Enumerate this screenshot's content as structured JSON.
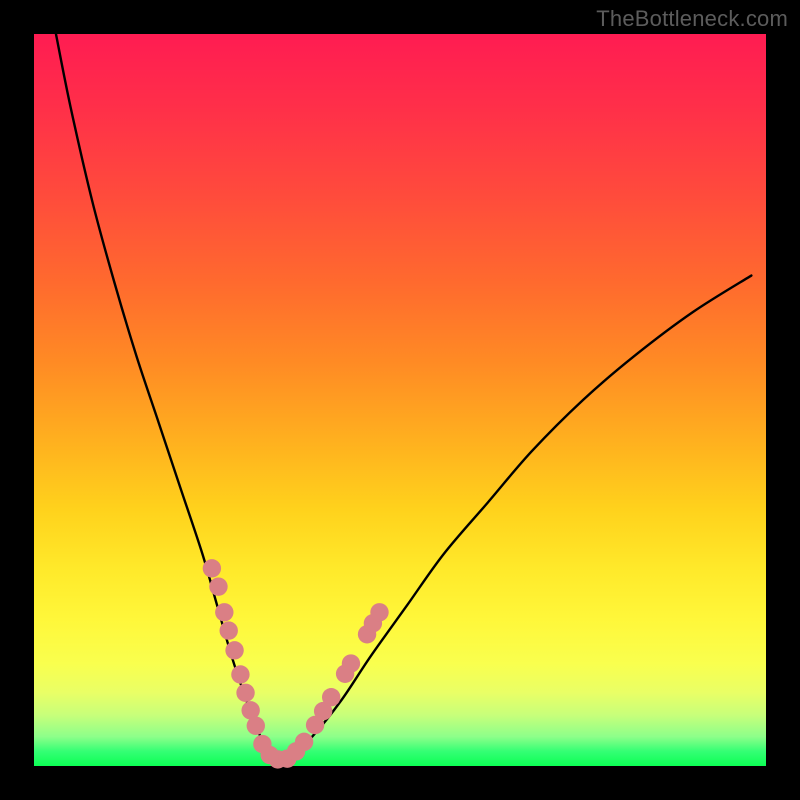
{
  "watermark": "TheBottleneck.com",
  "colors": {
    "frame": "#000000",
    "curve": "#000000",
    "marker_fill": "#da7f85",
    "gradient_top": "#ff1c52",
    "gradient_mid": "#ffae1f",
    "gradient_bottom": "#0cff54"
  },
  "chart_data": {
    "type": "line",
    "title": "",
    "xlabel": "",
    "ylabel": "",
    "xlim": [
      0,
      100
    ],
    "ylim": [
      0,
      100
    ],
    "series": [
      {
        "name": "curve",
        "x": [
          3,
          5,
          8,
          11,
          14,
          17,
          20,
          23,
          25,
          27,
          29,
          30.5,
          32,
          33.5,
          35,
          38,
          42,
          46,
          51,
          56,
          62,
          68,
          75,
          82,
          90,
          98
        ],
        "y": [
          100,
          90,
          77,
          66,
          56,
          47,
          38,
          29,
          22,
          15,
          9,
          5,
          2,
          0.8,
          1.2,
          4,
          9,
          15,
          22,
          29,
          36,
          43,
          50,
          56,
          62,
          67
        ]
      }
    ],
    "markers": [
      {
        "name": "left-arm-dots",
        "points": [
          {
            "x": 24.3,
            "y": 27.0
          },
          {
            "x": 25.2,
            "y": 24.5
          },
          {
            "x": 26.0,
            "y": 21.0
          },
          {
            "x": 26.6,
            "y": 18.5
          },
          {
            "x": 27.4,
            "y": 15.8
          },
          {
            "x": 28.2,
            "y": 12.5
          },
          {
            "x": 28.9,
            "y": 10.0
          },
          {
            "x": 29.6,
            "y": 7.6
          },
          {
            "x": 30.3,
            "y": 5.5
          },
          {
            "x": 31.2,
            "y": 3.0
          },
          {
            "x": 32.2,
            "y": 1.5
          },
          {
            "x": 33.3,
            "y": 0.9
          }
        ]
      },
      {
        "name": "right-arm-dots",
        "points": [
          {
            "x": 34.6,
            "y": 1.0
          },
          {
            "x": 35.8,
            "y": 2.0
          },
          {
            "x": 36.9,
            "y": 3.3
          },
          {
            "x": 38.4,
            "y": 5.6
          },
          {
            "x": 39.5,
            "y": 7.5
          },
          {
            "x": 40.6,
            "y": 9.4
          },
          {
            "x": 42.5,
            "y": 12.6
          },
          {
            "x": 43.3,
            "y": 14.0
          },
          {
            "x": 45.5,
            "y": 18.0
          },
          {
            "x": 46.3,
            "y": 19.5
          },
          {
            "x": 47.2,
            "y": 21.0
          }
        ]
      }
    ]
  }
}
